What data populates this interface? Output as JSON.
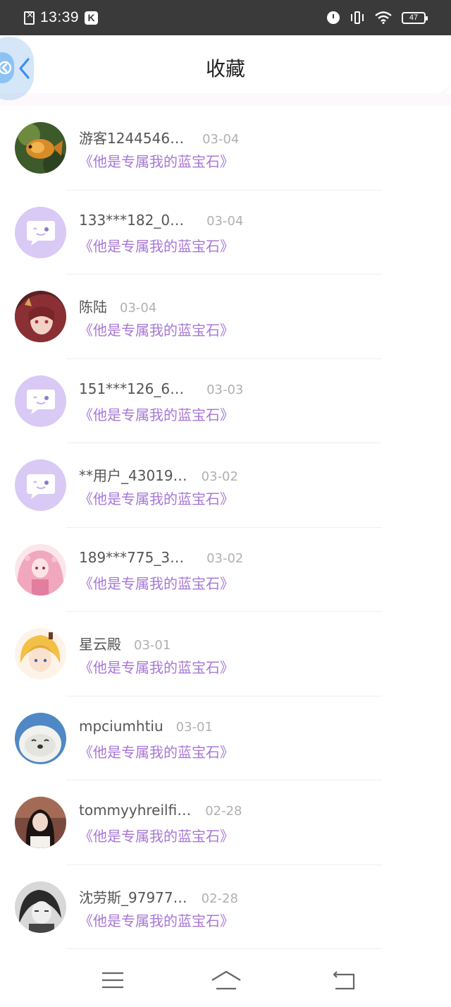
{
  "status_bar": {
    "time": "13:39",
    "k_badge": "K",
    "battery": "47",
    "icons": [
      "file-x-icon",
      "k-app-icon",
      "alarm-icon",
      "vibrate-icon",
      "wifi-icon",
      "battery-icon"
    ]
  },
  "header": {
    "title": "收藏",
    "back_icon": "chevron-left-icon",
    "floating_back_label": "<"
  },
  "items": [
    {
      "name": "游客1244546…",
      "date": "03-04",
      "book": "《他是专属我的蓝宝石》",
      "avatar": "goldfish"
    },
    {
      "name": "133***182_0…",
      "date": "03-04",
      "book": "《他是专属我的蓝宝石》",
      "avatar": "default"
    },
    {
      "name": "陈陆",
      "date": "03-04",
      "book": "《他是专属我的蓝宝石》",
      "avatar": "anime-red"
    },
    {
      "name": "151***126_6…",
      "date": "03-03",
      "book": "《他是专属我的蓝宝石》",
      "avatar": "default"
    },
    {
      "name": "**用户_43019…",
      "date": "03-02",
      "book": "《他是专属我的蓝宝石》",
      "avatar": "default"
    },
    {
      "name": "189***775_3…",
      "date": "03-02",
      "book": "《他是专属我的蓝宝石》",
      "avatar": "anime-pink"
    },
    {
      "name": "星云殿",
      "date": "03-01",
      "book": "《他是专属我的蓝宝石》",
      "avatar": "anime-blond"
    },
    {
      "name": "mpciumhtiu",
      "date": "03-01",
      "book": "《他是专属我的蓝宝石》",
      "avatar": "seal"
    },
    {
      "name": "tommyyhreilfi…",
      "date": "02-28",
      "book": "《他是专属我的蓝宝石》",
      "avatar": "girl-photo"
    },
    {
      "name": "沈劳斯_97977…",
      "date": "02-28",
      "book": "《他是专属我的蓝宝石》",
      "avatar": "monochrome"
    }
  ],
  "colors": {
    "status_bar_bg": "#3a3a3a",
    "book_title": "#a777d6",
    "default_avatar_bg": "#d9c9f5",
    "date": "#b0b0b0",
    "back_accent": "#3a8ef0"
  },
  "navbar": {
    "icons": [
      "menu-icon",
      "home-icon",
      "back-icon"
    ]
  }
}
